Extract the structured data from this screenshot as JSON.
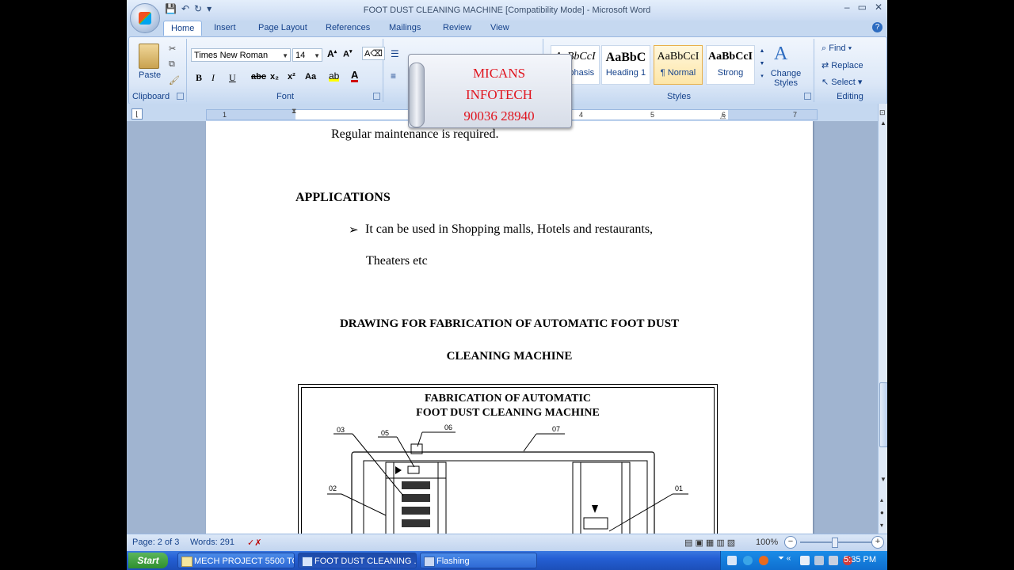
{
  "window": {
    "title": "FOOT DUST CLEANING MACHINE [Compatibility Mode] - Microsoft Word",
    "minimize": "–",
    "maximize": "▭",
    "close": "✕"
  },
  "qat": {
    "save": "💾",
    "undo": "↶",
    "redo": "↻",
    "customize": "▾"
  },
  "tabs": [
    "Home",
    "Insert",
    "Page Layout",
    "References",
    "Mailings",
    "Review",
    "View"
  ],
  "ribbon": {
    "clipboard": {
      "label": "Clipboard",
      "paste": "Paste"
    },
    "font": {
      "label": "Font",
      "family": "Times New Roman",
      "size": "14",
      "buttons": [
        "B",
        "I",
        "U",
        "abc",
        "x₂",
        "x²",
        "Aa"
      ]
    },
    "styles": {
      "label": "Styles",
      "items": [
        {
          "sample": "AaBbCcI",
          "name": "Emphasis"
        },
        {
          "sample": "AaBbC",
          "name": "Heading 1"
        },
        {
          "sample": "AaBbCcI",
          "name": "¶ Normal"
        },
        {
          "sample": "AaBbCcI",
          "name": "Strong"
        }
      ],
      "change_styles": "Change Styles"
    },
    "editing": {
      "label": "Editing",
      "find": "Find",
      "replace": "Replace",
      "select": "Select"
    }
  },
  "ruler": {
    "numbers": [
      "1",
      "4",
      "5",
      "6",
      "7"
    ]
  },
  "document": {
    "line1": "Regular maintenance is required.",
    "heading_applications": "APPLICATIONS",
    "bullet1": "It can be used in Shopping malls, Hotels and restaurants,",
    "bullet1_cont": "Theaters etc",
    "drawing_heading1": "DRAWING FOR FABRICATION OF AUTOMATIC FOOT DUST",
    "drawing_heading2": "CLEANING MACHINE",
    "figure": {
      "title1": "FABRICATION OF AUTOMATIC",
      "title2": "FOOT DUST CLEANING MACHINE",
      "parts": [
        "03",
        "05",
        "06",
        "07",
        "02",
        "01"
      ]
    }
  },
  "watermark": {
    "line1": "MICANS",
    "line2": "INFOTECH",
    "line3": "90036 28940"
  },
  "statusbar": {
    "page": "Page: 2 of 3",
    "words": "Words: 291",
    "zoom": "100%"
  },
  "taskbar": {
    "start": "Start",
    "buttons": [
      "MECH PROJECT 5500 TO...",
      "FOOT DUST CLEANING ...",
      "Flashing"
    ],
    "clock": "5:35 PM"
  },
  "colors": {
    "watermark_text": "#e0141e",
    "ribbon_text": "#15428b",
    "taskbar": "#245ed4"
  }
}
